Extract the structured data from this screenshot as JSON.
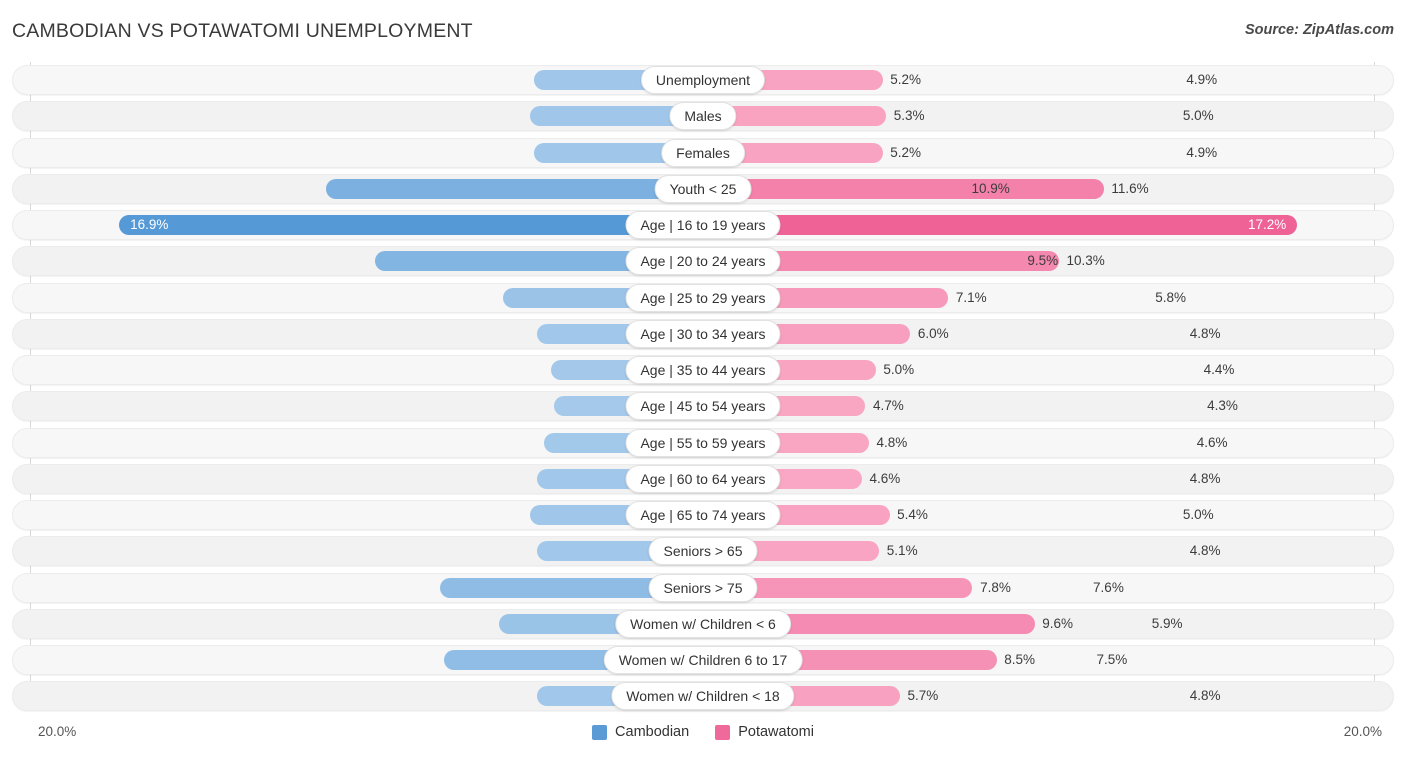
{
  "header": {
    "title": "CAMBODIAN VS POTAWATOMI UNEMPLOYMENT",
    "source": "Source: ZipAtlas.com"
  },
  "legend": {
    "left_label": "Cambodian",
    "right_label": "Potawatomi",
    "left_color": "#5b9bd5",
    "right_color": "#f0699b"
  },
  "axis": {
    "min_label": "20.0%",
    "max_label": "20.0%",
    "max_value": 20.0
  },
  "chart_data": {
    "type": "bar",
    "orientation": "horizontal-diverging",
    "title": "CAMBODIAN VS POTAWATOMI UNEMPLOYMENT",
    "xlabel": "",
    "ylabel": "",
    "xlim": [
      20.0,
      20.0
    ],
    "grid": false,
    "legend_position": "bottom-center",
    "categories": [
      "Unemployment",
      "Males",
      "Females",
      "Youth < 25",
      "Age | 16 to 19 years",
      "Age | 20 to 24 years",
      "Age | 25 to 29 years",
      "Age | 30 to 34 years",
      "Age | 35 to 44 years",
      "Age | 45 to 54 years",
      "Age | 55 to 59 years",
      "Age | 60 to 64 years",
      "Age | 65 to 74 years",
      "Seniors > 65",
      "Seniors > 75",
      "Women w/ Children < 6",
      "Women w/ Children 6 to 17",
      "Women w/ Children < 18"
    ],
    "series": [
      {
        "name": "Cambodian",
        "color": "#5b9bd5",
        "values": [
          4.9,
          5.0,
          4.9,
          10.9,
          16.9,
          9.5,
          5.8,
          4.8,
          4.4,
          4.3,
          4.6,
          4.8,
          5.0,
          4.8,
          7.6,
          5.9,
          7.5,
          4.8
        ],
        "labels": [
          "4.9%",
          "5.0%",
          "4.9%",
          "10.9%",
          "16.9%",
          "9.5%",
          "5.8%",
          "4.8%",
          "4.4%",
          "4.3%",
          "4.6%",
          "4.8%",
          "5.0%",
          "4.8%",
          "7.6%",
          "5.9%",
          "7.5%",
          "4.8%"
        ]
      },
      {
        "name": "Potawatomi",
        "color": "#f0699b",
        "values": [
          5.2,
          5.3,
          5.2,
          11.6,
          17.2,
          10.3,
          7.1,
          6.0,
          5.0,
          4.7,
          4.8,
          4.6,
          5.4,
          5.1,
          7.8,
          9.6,
          8.5,
          5.7
        ],
        "labels": [
          "5.2%",
          "5.3%",
          "5.2%",
          "11.6%",
          "17.2%",
          "10.3%",
          "7.1%",
          "6.0%",
          "5.0%",
          "4.7%",
          "4.8%",
          "4.6%",
          "5.4%",
          "5.1%",
          "7.8%",
          "9.6%",
          "8.5%",
          "5.7%"
        ]
      }
    ]
  }
}
